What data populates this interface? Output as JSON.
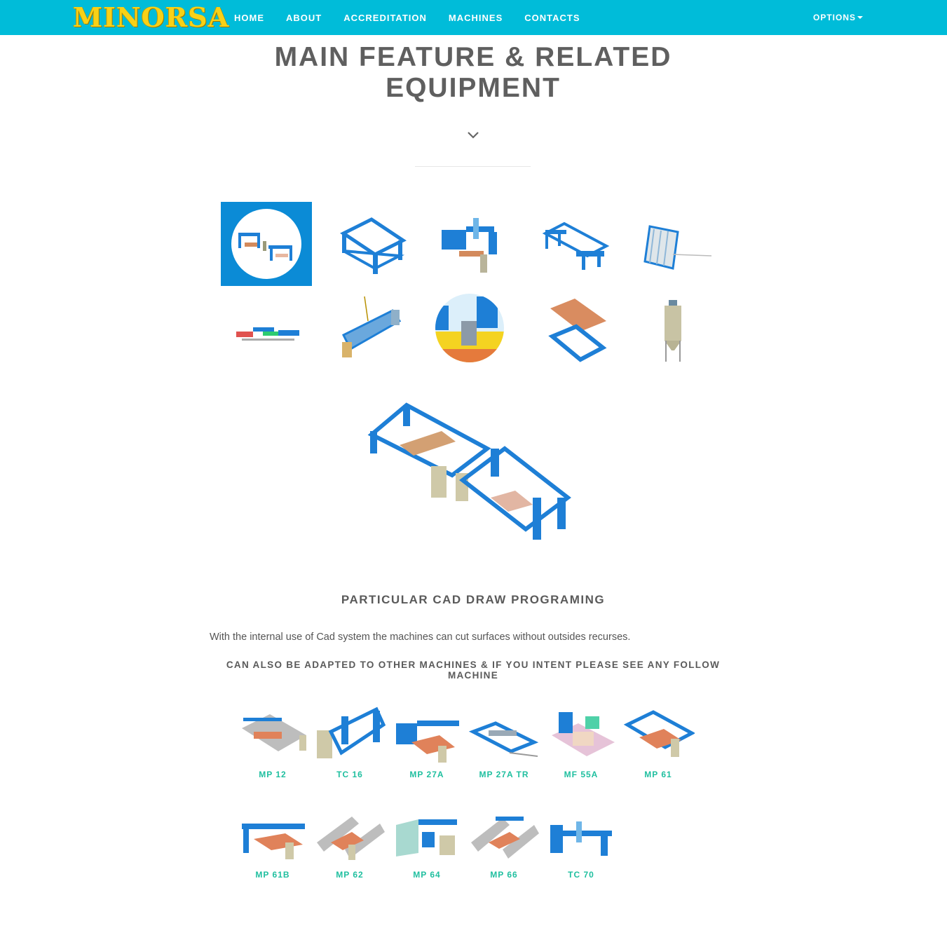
{
  "brand": {
    "logo_text": "MINORSA"
  },
  "nav": {
    "items": [
      "HOME",
      "ABOUT",
      "ACCREDITATION",
      "MACHINES",
      "CONTACTS"
    ],
    "options_label": "OPTIONS"
  },
  "header": {
    "title_line1": "MAIN FEATURE & RELATED",
    "title_line2": "EQUIPMENT"
  },
  "section": {
    "heading": "PARTICULAR CAD DRAW PROGRAMING",
    "text": "With the internal use of Cad system the machines can cut surfaces without outsides recurses.",
    "adapt_line1": "CAN ALSO BE ADAPTED TO OTHER MACHINES & IF YOU INTENT PLEASE SEE ANY FOLLOW",
    "adapt_line2": "MACHINE"
  },
  "machines": [
    "MP 12",
    "TC 16",
    "MP 27A",
    "MP 27A TR",
    "MF 55A",
    "MP 61",
    "MP 61B",
    "MP 62",
    "MP 64",
    "MP 66",
    "TC 70"
  ],
  "colors": {
    "navbar": "#00bcd9",
    "accent_blue": "#0b8bd6",
    "machine_label": "#1fbf9f",
    "logo": "#f7d117"
  }
}
